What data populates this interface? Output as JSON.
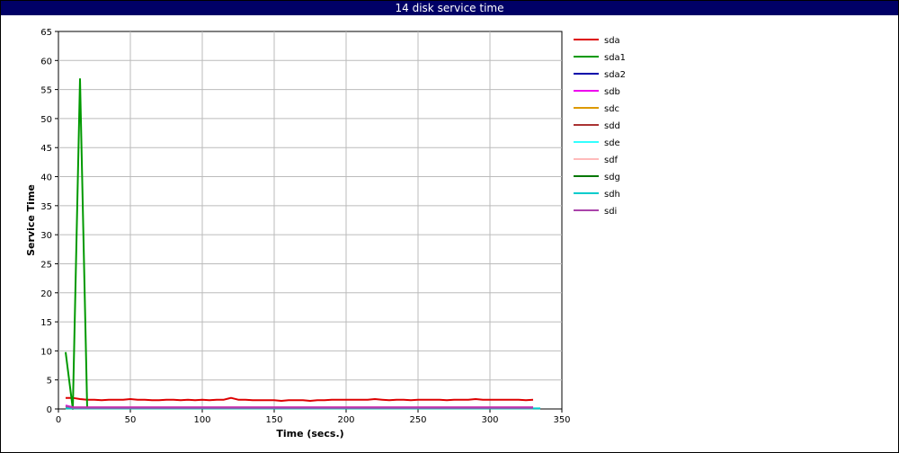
{
  "window": {
    "title": "14 disk service time"
  },
  "chart_data": {
    "type": "line",
    "title": "14 disk service time",
    "xlabel": "Time (secs.)",
    "ylabel": "Service Time",
    "xlim": [
      0,
      350
    ],
    "ylim": [
      0,
      65
    ],
    "xticks": [
      0,
      50,
      100,
      150,
      200,
      250,
      300,
      350
    ],
    "yticks": [
      0,
      5,
      10,
      15,
      20,
      25,
      30,
      35,
      40,
      45,
      50,
      55,
      60,
      65
    ],
    "grid": true,
    "legend_position": "right",
    "series": [
      {
        "name": "sda",
        "color": "#dd0000",
        "x": [
          5,
          10,
          15,
          20,
          25,
          30,
          35,
          40,
          45,
          50,
          55,
          60,
          65,
          70,
          75,
          80,
          85,
          90,
          95,
          100,
          105,
          110,
          115,
          120,
          125,
          130,
          135,
          140,
          145,
          150,
          155,
          160,
          165,
          170,
          175,
          180,
          185,
          190,
          195,
          200,
          205,
          210,
          215,
          220,
          225,
          230,
          235,
          240,
          245,
          250,
          255,
          260,
          265,
          270,
          275,
          280,
          285,
          290,
          295,
          300,
          305,
          310,
          315,
          320,
          325,
          330
        ],
        "y": [
          1.9,
          1.9,
          1.7,
          1.6,
          1.6,
          1.5,
          1.6,
          1.6,
          1.6,
          1.7,
          1.6,
          1.6,
          1.5,
          1.5,
          1.6,
          1.6,
          1.5,
          1.6,
          1.5,
          1.6,
          1.5,
          1.6,
          1.6,
          1.9,
          1.6,
          1.6,
          1.5,
          1.5,
          1.5,
          1.5,
          1.4,
          1.5,
          1.5,
          1.5,
          1.4,
          1.5,
          1.5,
          1.6,
          1.6,
          1.6,
          1.6,
          1.6,
          1.6,
          1.7,
          1.6,
          1.5,
          1.6,
          1.6,
          1.5,
          1.6,
          1.6,
          1.6,
          1.6,
          1.5,
          1.6,
          1.6,
          1.6,
          1.7,
          1.6,
          1.6,
          1.6,
          1.6,
          1.6,
          1.6,
          1.5,
          1.6
        ]
      },
      {
        "name": "sda1",
        "color": "#009900",
        "x": [
          5,
          10,
          15,
          20
        ],
        "y": [
          9.8,
          0.0,
          56.8,
          0.0
        ]
      },
      {
        "name": "sda2",
        "color": "#0000aa",
        "x": [
          5,
          330
        ],
        "y": [
          0.1,
          0.1
        ]
      },
      {
        "name": "sdb",
        "color": "#ee00ee",
        "x": [
          5,
          10,
          330
        ],
        "y": [
          0.6,
          0.3,
          0.3
        ]
      },
      {
        "name": "sdc",
        "color": "#dd9900",
        "x": [
          5,
          330
        ],
        "y": [
          0.2,
          0.2
        ]
      },
      {
        "name": "sdd",
        "color": "#aa3333",
        "x": [
          5,
          330
        ],
        "y": [
          0.2,
          0.2
        ]
      },
      {
        "name": "sde",
        "color": "#33ffff",
        "x": [
          5,
          330
        ],
        "y": [
          0.1,
          0.1
        ]
      },
      {
        "name": "sdf",
        "color": "#ffbbbb",
        "x": [
          5,
          330
        ],
        "y": [
          0.1,
          0.1
        ]
      },
      {
        "name": "sdg",
        "color": "#007700",
        "x": [
          5,
          330
        ],
        "y": [
          0.1,
          0.1
        ]
      },
      {
        "name": "sdh",
        "color": "#00cccc",
        "x": [
          5,
          335
        ],
        "y": [
          0.1,
          0.1
        ]
      },
      {
        "name": "sdi",
        "color": "#aa44aa",
        "x": [
          5,
          10,
          330
        ],
        "y": [
          0.5,
          0.2,
          0.2
        ]
      }
    ]
  }
}
